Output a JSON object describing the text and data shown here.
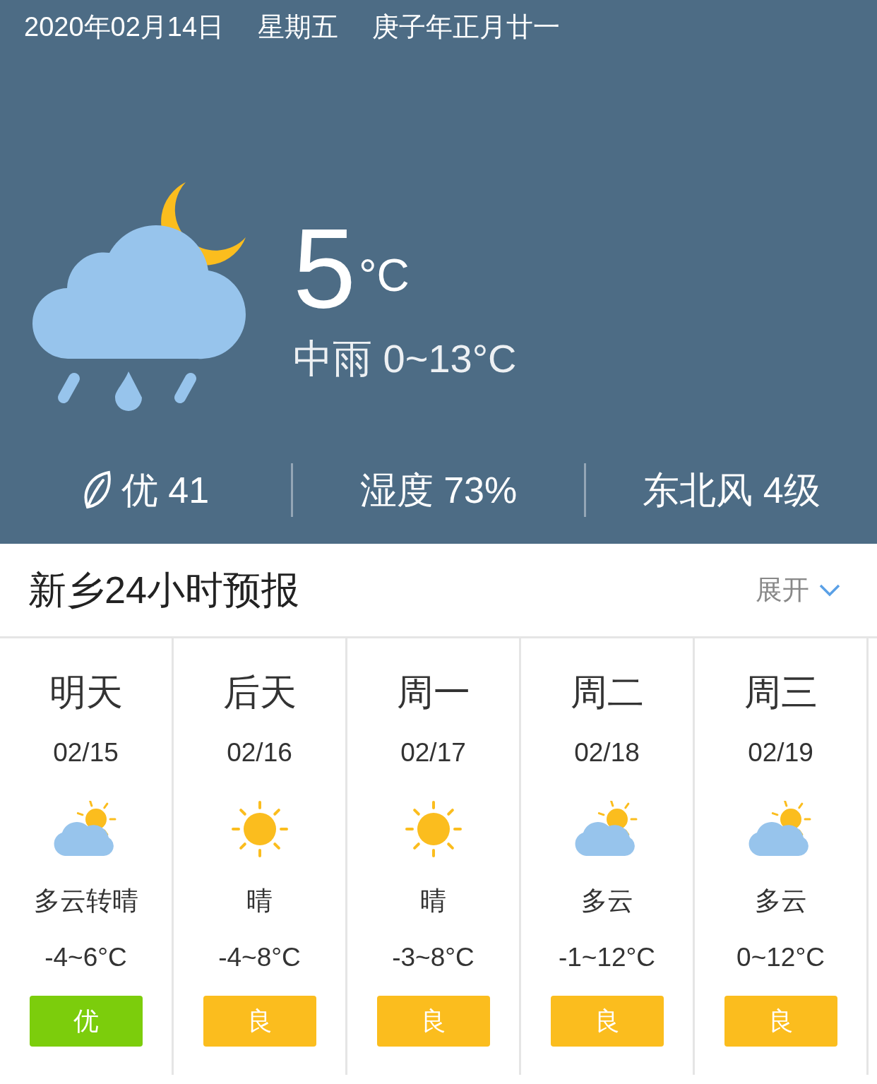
{
  "header": {
    "date": "2020年02月14日",
    "weekday": "星期五",
    "lunar": "庚子年正月廿一"
  },
  "current": {
    "kind": "rain_night",
    "temperature": "5",
    "unit": "°C",
    "summary": "中雨 0~13°C"
  },
  "stats": [
    {
      "kind": "air",
      "text": "优 41"
    },
    {
      "kind": "plain",
      "text": "湿度 73%"
    },
    {
      "kind": "plain",
      "text": "东北风 4级"
    }
  ],
  "forecast_title": "新乡24小时预报",
  "expand": "展开",
  "days": [
    {
      "day": "明天",
      "date": "02/15",
      "kind": "cloud_sun",
      "condition": "多云转晴",
      "temp": "-4~6°C",
      "aqi": "优",
      "color": "#7ccd0c"
    },
    {
      "day": "后天",
      "date": "02/16",
      "kind": "sun",
      "condition": "晴",
      "temp": "-4~8°C",
      "aqi": "良",
      "color": "#fbbd1e"
    },
    {
      "day": "周一",
      "date": "02/17",
      "kind": "sun",
      "condition": "晴",
      "temp": "-3~8°C",
      "aqi": "良",
      "color": "#fbbd1e"
    },
    {
      "day": "周二",
      "date": "02/18",
      "kind": "cloud_sun",
      "condition": "多云",
      "temp": "-1~12°C",
      "aqi": "良",
      "color": "#fbbd1e"
    },
    {
      "day": "周三",
      "date": "02/19",
      "kind": "cloud_sun",
      "condition": "多云",
      "temp": "0~12°C",
      "aqi": "良",
      "color": "#fbbd1e"
    }
  ]
}
